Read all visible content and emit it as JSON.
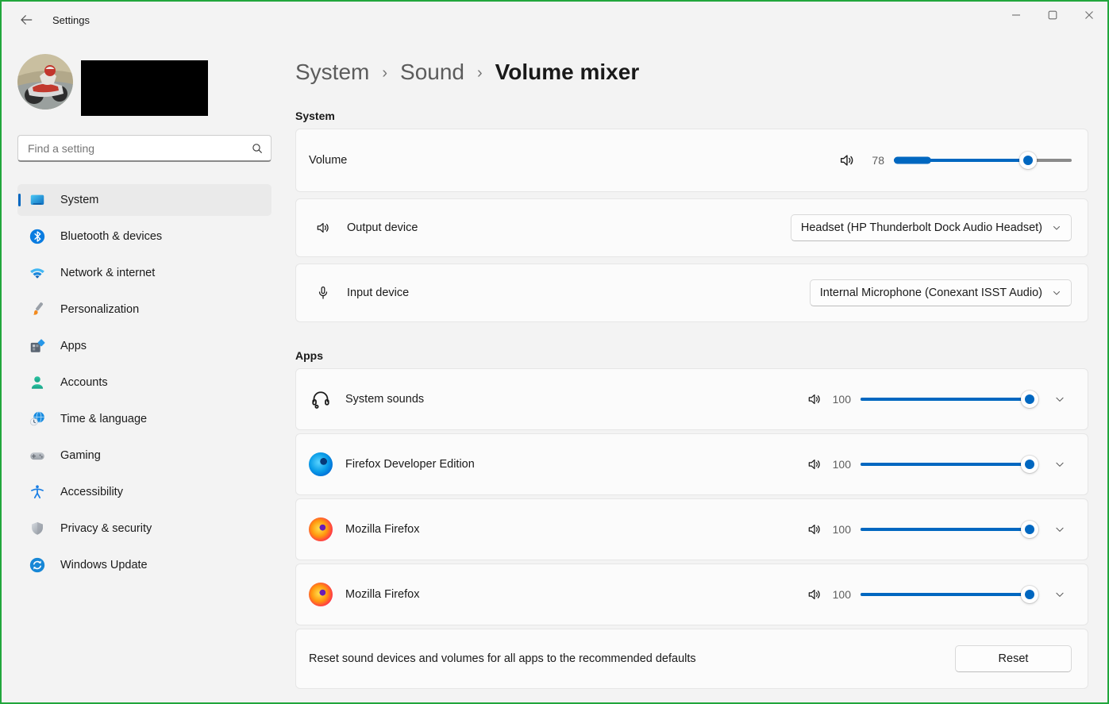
{
  "titlebar": {
    "title": "Settings",
    "back_icon": "back-arrow-icon",
    "window_buttons": [
      "minimize",
      "maximize",
      "close"
    ]
  },
  "user": {
    "avatar": "motorcycle-racer-photo",
    "name_redacted": true
  },
  "sidebar": {
    "search_placeholder": "Find a setting",
    "items": [
      {
        "label": "System",
        "icon": "system-icon",
        "selected": true
      },
      {
        "label": "Bluetooth & devices",
        "icon": "bluetooth-icon",
        "selected": false
      },
      {
        "label": "Network & internet",
        "icon": "network-icon",
        "selected": false
      },
      {
        "label": "Personalization",
        "icon": "personalization-icon",
        "selected": false
      },
      {
        "label": "Apps",
        "icon": "apps-icon",
        "selected": false
      },
      {
        "label": "Accounts",
        "icon": "accounts-icon",
        "selected": false
      },
      {
        "label": "Time & language",
        "icon": "time-language-icon",
        "selected": false
      },
      {
        "label": "Gaming",
        "icon": "gaming-icon",
        "selected": false
      },
      {
        "label": "Accessibility",
        "icon": "accessibility-icon",
        "selected": false
      },
      {
        "label": "Privacy & security",
        "icon": "privacy-security-icon",
        "selected": false
      },
      {
        "label": "Windows Update",
        "icon": "windows-update-icon",
        "selected": false
      }
    ]
  },
  "breadcrumb": {
    "path": [
      "System",
      "Sound",
      "Volume mixer"
    ],
    "separator": "›"
  },
  "system_section": {
    "header": "System",
    "volume_row": {
      "label": "Volume",
      "value": 78,
      "max": 100,
      "icon": "speaker-icon"
    },
    "output_row": {
      "label": "Output device",
      "icon": "speaker-icon",
      "selected_option": "Headset (HP Thunderbolt Dock Audio Headset)"
    },
    "input_row": {
      "label": "Input device",
      "icon": "microphone-icon",
      "selected_option": "Internal Microphone (Conexant ISST Audio)"
    }
  },
  "apps_section": {
    "header": "Apps",
    "rows": [
      {
        "name": "System sounds",
        "icon": "headset-icon",
        "volume": 100
      },
      {
        "name": "Firefox Developer Edition",
        "icon": "firefox-developer-icon",
        "volume": 100
      },
      {
        "name": "Mozilla Firefox",
        "icon": "firefox-icon",
        "volume": 100
      },
      {
        "name": "Mozilla Firefox",
        "icon": "firefox-icon",
        "volume": 100
      }
    ]
  },
  "reset_section": {
    "description": "Reset sound devices and volumes for all apps to the recommended defaults",
    "button_label": "Reset"
  },
  "colors": {
    "accent": "#0067c0",
    "frame_border": "#21a63c",
    "page_background": "#f3f3f3",
    "card_background": "#fbfbfb",
    "slider_track_gray": "#8a8a8a"
  }
}
